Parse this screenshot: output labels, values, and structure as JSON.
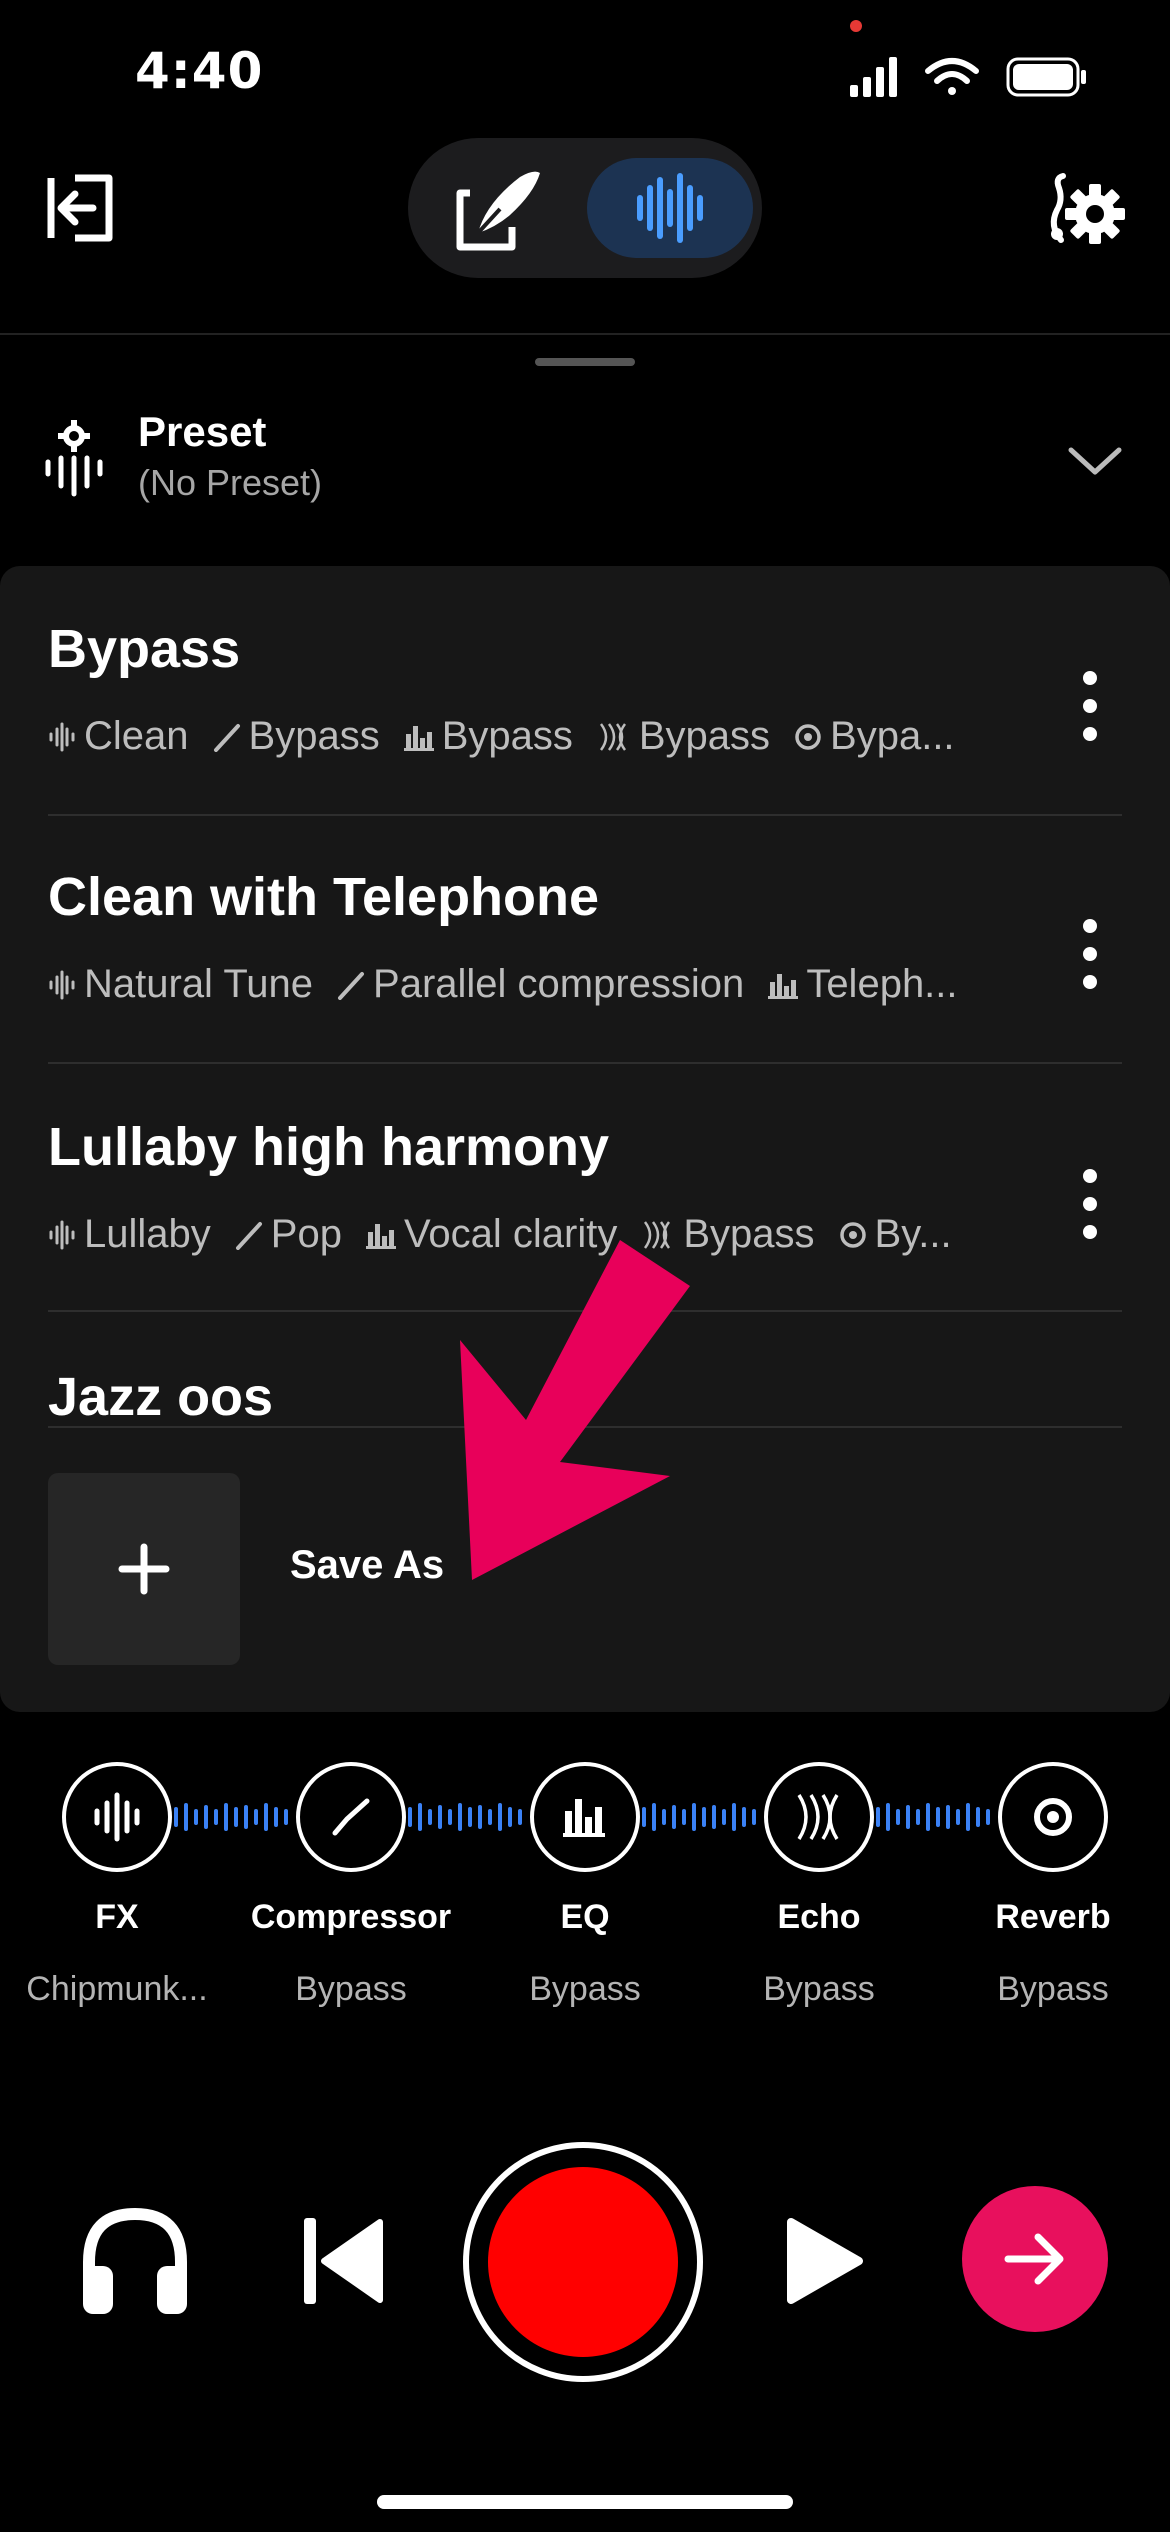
{
  "status_bar": {
    "time": "4:40"
  },
  "preset": {
    "title": "Preset",
    "subtitle": "(No Preset)"
  },
  "presets": [
    {
      "name": "Bypass",
      "tags": [
        {
          "icon": "fx-icon",
          "label": "Clean"
        },
        {
          "icon": "compressor-icon",
          "label": "Bypass"
        },
        {
          "icon": "eq-icon",
          "label": "Bypass"
        },
        {
          "icon": "echo-icon",
          "label": "Bypass"
        },
        {
          "icon": "reverb-icon",
          "label": "Bypa..."
        }
      ]
    },
    {
      "name": "Clean with Telephone",
      "tags": [
        {
          "icon": "fx-icon",
          "label": "Natural Tune"
        },
        {
          "icon": "compressor-icon",
          "label": "Parallel compression"
        },
        {
          "icon": "eq-icon",
          "label": "Teleph..."
        }
      ]
    },
    {
      "name": "Lullaby high harmony",
      "tags": [
        {
          "icon": "fx-icon",
          "label": "Lullaby"
        },
        {
          "icon": "compressor-icon",
          "label": "Pop"
        },
        {
          "icon": "eq-icon",
          "label": "Vocal clarity"
        },
        {
          "icon": "echo-icon",
          "label": "Bypass"
        },
        {
          "icon": "reverb-icon",
          "label": "By..."
        }
      ]
    },
    {
      "name": "Jazz oos",
      "tags": []
    }
  ],
  "save_as": {
    "label": "Save As"
  },
  "chain": [
    {
      "name": "FX",
      "value": "Chipmunk...",
      "icon": "fx-icon"
    },
    {
      "name": "Compressor",
      "value": "Bypass",
      "icon": "compressor-icon"
    },
    {
      "name": "EQ",
      "value": "Bypass",
      "icon": "eq-icon"
    },
    {
      "name": "Echo",
      "value": "Bypass",
      "icon": "echo-icon"
    },
    {
      "name": "Reverb",
      "value": "Bypass",
      "icon": "reverb-icon"
    }
  ],
  "colors": {
    "accent": "#e8105d",
    "record": "#ff0000",
    "wave": "#3b82f6",
    "annotation_arrow": "#e8005a"
  }
}
